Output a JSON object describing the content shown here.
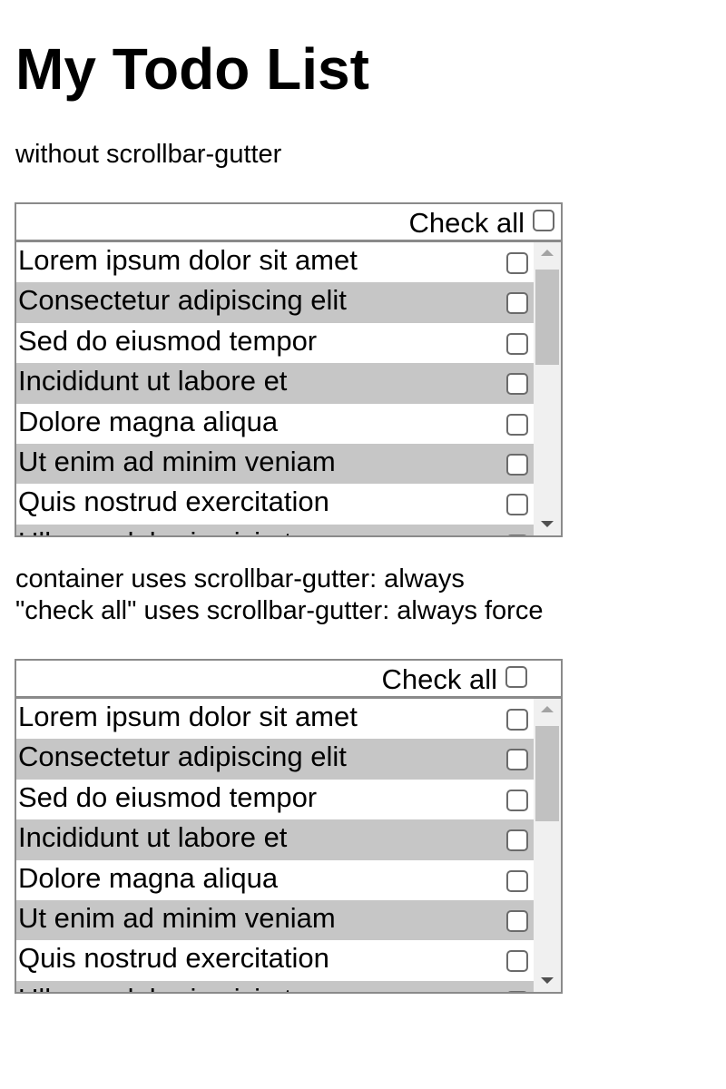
{
  "page": {
    "title": "My Todo List"
  },
  "sections": [
    {
      "caption": "without scrollbar-gutter",
      "check_all_label": "Check all",
      "items": [
        {
          "text": "Lorem ipsum dolor sit amet",
          "checked": false
        },
        {
          "text": "Consectetur adipiscing elit",
          "checked": false
        },
        {
          "text": "Sed do eiusmod tempor",
          "checked": false
        },
        {
          "text": "Incididunt ut labore et",
          "checked": false
        },
        {
          "text": "Dolore magna aliqua",
          "checked": false
        },
        {
          "text": "Ut enim ad minim veniam",
          "checked": false
        },
        {
          "text": "Quis nostrud exercitation",
          "checked": false
        },
        {
          "text": "Ullamco laboris nisi ut",
          "checked": false
        }
      ]
    },
    {
      "caption_line1": "container uses scrollbar-gutter: always",
      "caption_line2": "\"check all\" uses scrollbar-gutter: always force",
      "check_all_label": "Check all",
      "items": [
        {
          "text": "Lorem ipsum dolor sit amet",
          "checked": false
        },
        {
          "text": "Consectetur adipiscing elit",
          "checked": false
        },
        {
          "text": "Sed do eiusmod tempor",
          "checked": false
        },
        {
          "text": "Incididunt ut labore et",
          "checked": false
        },
        {
          "text": "Dolore magna aliqua",
          "checked": false
        },
        {
          "text": "Ut enim ad minim veniam",
          "checked": false
        },
        {
          "text": "Quis nostrud exercitation",
          "checked": false
        },
        {
          "text": "Ullamco laboris nisi ut",
          "checked": false
        }
      ]
    }
  ],
  "colors": {
    "row_alt": "#c6c6c6",
    "border": "#8a8a8a",
    "scroll_track": "#f0f0f0",
    "scroll_thumb": "#c1c1c1"
  },
  "icons": {
    "scroll_up": "triangle-up",
    "scroll_down": "triangle-down"
  }
}
